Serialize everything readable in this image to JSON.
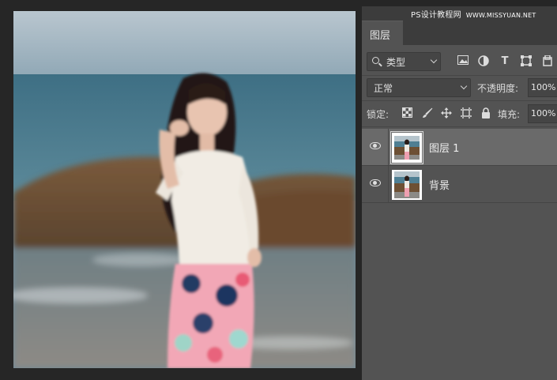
{
  "watermark": {
    "cn": "PS设计教程网",
    "url": "WWW.MISSYUAN.NET"
  },
  "panel": {
    "tab_label": "图层",
    "filter": {
      "kind_label": "类型",
      "icons": [
        "image-filter-icon",
        "adjustment-filter-icon",
        "type-filter-icon",
        "shape-filter-icon",
        "smart-object-filter-icon"
      ]
    },
    "blend_mode": "正常",
    "opacity_label": "不透明度:",
    "opacity_value": "100%",
    "lock_label": "锁定:",
    "lock_icons": [
      "lock-transparent-icon",
      "lock-paint-icon",
      "lock-position-icon",
      "lock-artboard-icon",
      "lock-all-icon"
    ],
    "fill_label": "填充:",
    "fill_value": "100%",
    "layers": [
      {
        "name": "图层 1",
        "selected": true,
        "visible": true
      },
      {
        "name": "背景",
        "selected": false,
        "visible": true
      }
    ]
  },
  "colors": {
    "panel_bg": "#535353",
    "selected_layer": "#6a6a6a",
    "app_bg": "#262626"
  }
}
